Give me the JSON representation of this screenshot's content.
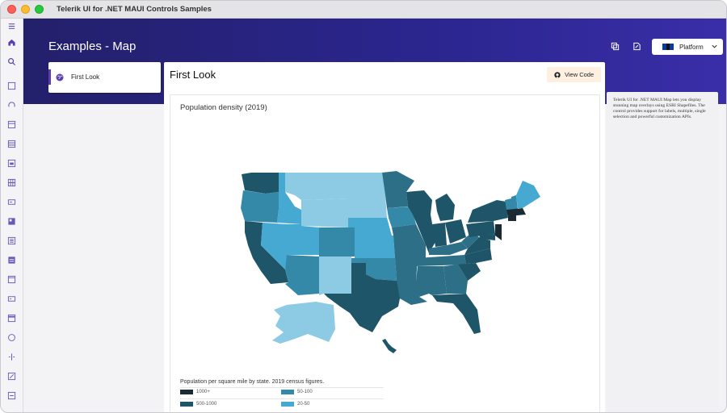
{
  "window": {
    "title": "Telerik UI for .NET MAUI Controls Samples"
  },
  "header": {
    "title": "Examples - Map",
    "platform_label": "Platform"
  },
  "examples": [
    {
      "label": "First Look"
    }
  ],
  "main": {
    "title": "First Look",
    "view_code_label": "View Code",
    "map_title": "Population density (2019)",
    "legend_caption": "Population per square mile by state. 2019 census figures.",
    "legend": [
      {
        "label": "1000+",
        "color": "#1b2a33"
      },
      {
        "label": "50-100",
        "color": "#3589a8"
      },
      {
        "label": "500-1000",
        "color": "#1f5568"
      },
      {
        "label": "20-50",
        "color": "#46a9d2"
      }
    ]
  },
  "description": "Telerik UI for .NET MAUI Map lets you display stunning map overlays using ESRI Shapefiles. The control provides support for labels, multiple, single selection and powerful customization APIs.",
  "colors": {
    "accent": "#5b3fb0",
    "band": "#2b2690",
    "c1000": "#1b2a33",
    "c500": "#1f5568",
    "c100": "#2c6f87",
    "c50": "#3589a8",
    "c20": "#46a9d2",
    "c0": "#8ccbe3"
  },
  "rail_icons": [
    "menu-icon",
    "home-icon",
    "search-icon",
    "control-icon",
    "control-icon",
    "control-icon",
    "control-icon",
    "control-icon",
    "control-icon",
    "control-icon",
    "control-icon",
    "control-icon",
    "control-icon",
    "control-icon",
    "control-icon",
    "control-icon",
    "control-icon",
    "control-icon",
    "control-icon",
    "control-icon"
  ]
}
